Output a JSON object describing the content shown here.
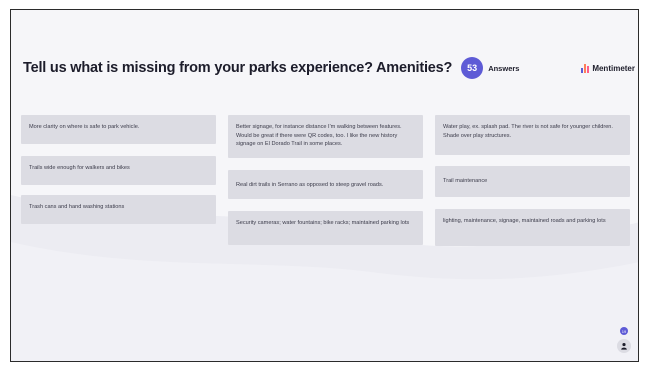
{
  "question": {
    "title": "Tell us what is missing from your parks experience? Amenities?",
    "count": "53",
    "count_label": "Answers"
  },
  "brand": {
    "name": "Mentimeter",
    "icon": "mentimeter-bars-icon",
    "colors": [
      "#5e5bd6",
      "#ff7f5c",
      "#ff5c8a"
    ]
  },
  "accent_color": "#5e5bd6",
  "card_color": "#dcdce3",
  "columns": [
    {
      "cards": [
        "More clarity on where is safe to park vehicle.",
        "Trails wide enough for walkers and bikes",
        "Trash cans and hand washing stations"
      ]
    },
    {
      "cards": [
        "Better signage, for instance distance I'm walking between features. Would be great if there were QR codes, too. I like the new history signage on El Dorado Trail in some places.",
        "Real dirt trails in Serrano as opposed to steep gravel roads.",
        "Security cameras; water fountains; bike racks; maintained parking lots"
      ]
    },
    {
      "cards": [
        "Water play, ex. splash pad. The river is not safe for younger children. Shade over play structures.",
        "Trail maintenance",
        "lighting, maintenance, signage, maintained roads and parking lots"
      ]
    }
  ],
  "participants": {
    "badge": "19",
    "icon": "person-icon"
  }
}
